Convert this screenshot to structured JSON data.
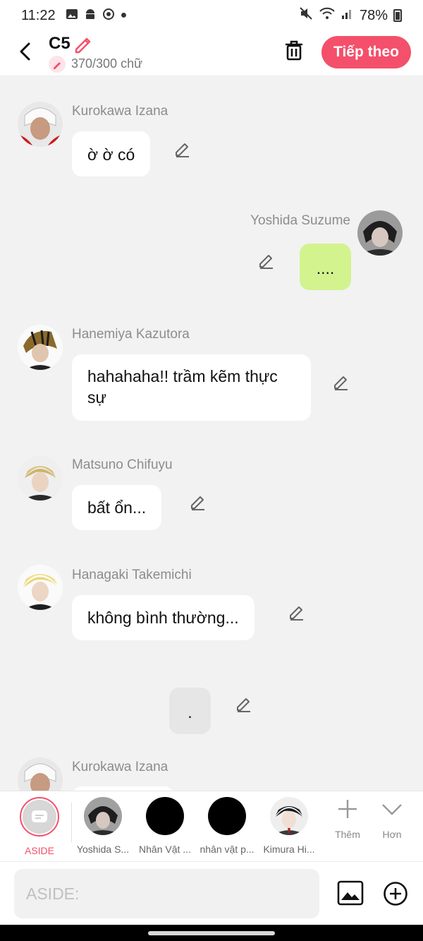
{
  "status": {
    "time": "11:22",
    "battery": "78%"
  },
  "header": {
    "title": "C5",
    "count": "370/300 chữ",
    "next_label": "Tiếp theo"
  },
  "messages": [
    {
      "name": "Kurokawa Izana",
      "text": "ờ ờ có"
    },
    {
      "name": "Yoshida Suzume",
      "text": "...."
    },
    {
      "name": "Hanemiya Kazutora",
      "text": "hahahaha!! trầm kẽm thực sự"
    },
    {
      "name": "Matsuno Chifuyu",
      "text": "bất ổn..."
    },
    {
      "name": "Hanagaki Takemichi",
      "text": "không bình thường..."
    },
    {
      "name": "",
      "text": "."
    },
    {
      "name": "Kurokawa Izana",
      "text": ""
    }
  ],
  "characters": [
    {
      "label": "ASIDE"
    },
    {
      "label": "Yoshida S..."
    },
    {
      "label": "Nhân Vật ..."
    },
    {
      "label": "nhân vật p..."
    },
    {
      "label": "Kimura Hi..."
    }
  ],
  "tools": {
    "more_label": "Thêm",
    "less_label": "Hơn"
  },
  "composer": {
    "placeholder": "ASIDE:"
  },
  "colors": {
    "accent": "#f4506b",
    "my_bubble": "#d3f38f",
    "background": "#f2f2f2"
  }
}
